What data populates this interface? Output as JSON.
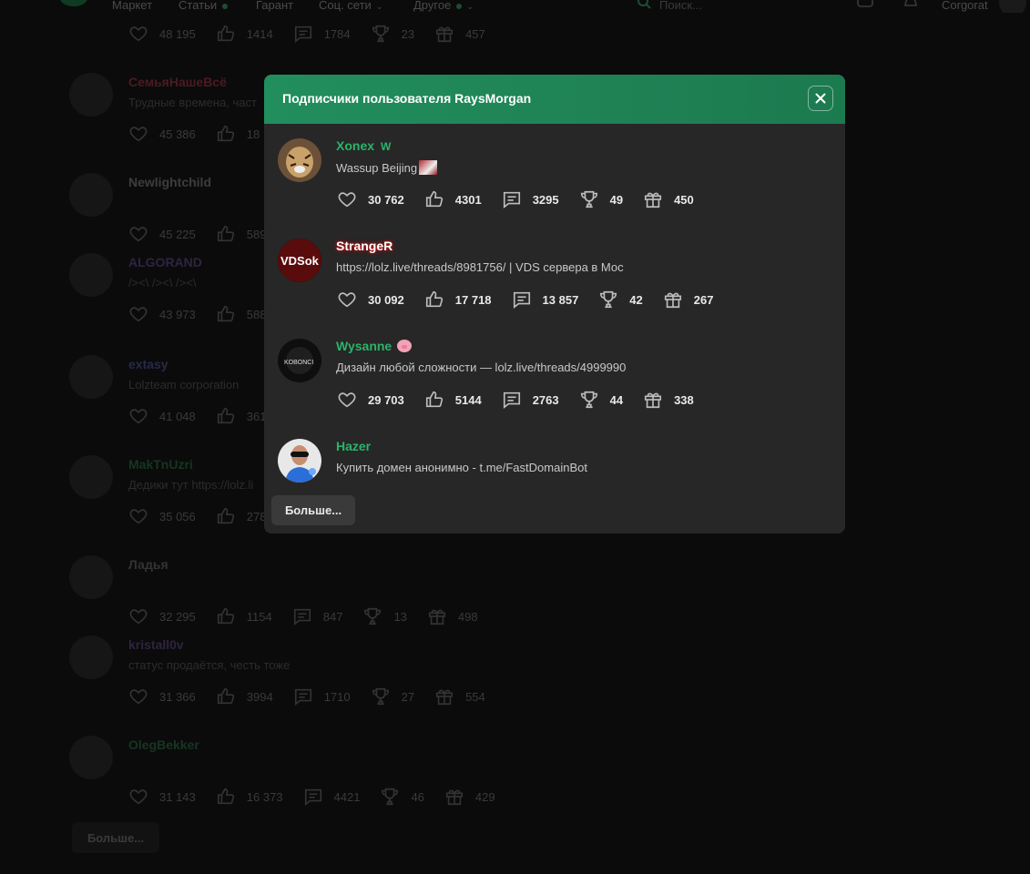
{
  "nav": {
    "items": [
      {
        "label": "Маркет",
        "chevron": false,
        "dot": false
      },
      {
        "label": "Статьи",
        "chevron": false,
        "dot": true
      },
      {
        "label": "Гарант",
        "chevron": false,
        "dot": false
      },
      {
        "label": "Соц. сети",
        "chevron": true,
        "dot": false
      },
      {
        "label": "Другое",
        "chevron": true,
        "dot": true
      }
    ],
    "search_placeholder": "Поиск...",
    "username": "Corgorat"
  },
  "background": {
    "top_stats": {
      "likes": "48 195",
      "reactions": "1414",
      "messages": "1784",
      "trophies": "23",
      "gifts": "457"
    },
    "rows": [
      {
        "name": "СемьяНашеВсё",
        "name_color": "#4a1b22",
        "status": "Трудные времена, част",
        "stats": {
          "likes": "45 386",
          "reactions": "18"
        }
      },
      {
        "name": "Newlightchild",
        "name_color": "#3d3d3d",
        "status": "",
        "stats": {
          "likes": "45 225",
          "reactions": "589"
        }
      },
      {
        "name": "ALGORAND",
        "name_color": "#2f2440",
        "status": "/><\\ /><\\ /><\\",
        "stats": {
          "likes": "43 973",
          "reactions": "588"
        }
      },
      {
        "name": "extasy",
        "name_color": "#262a4a",
        "status": "Lolzteam corporation",
        "stats": {
          "likes": "41 048",
          "reactions": "361"
        }
      },
      {
        "name": "MakTnUzri",
        "name_color": "#173522",
        "status": "Дедики тут https://lolz.li",
        "stats": {
          "likes": "35 056",
          "reactions": "278"
        }
      },
      {
        "name": "Ладья",
        "name_color": "#333333",
        "status": "",
        "stats": {
          "likes": "32 295",
          "reactions": "1154",
          "messages": "847",
          "trophies": "13",
          "gifts": "498"
        }
      },
      {
        "name": "kristall0v",
        "name_color": "#2f2440",
        "status": "статус продаётся, честь тоже",
        "stats": {
          "likes": "31 366",
          "reactions": "3994",
          "messages": "1710",
          "trophies": "27",
          "gifts": "554"
        }
      },
      {
        "name": "OlegBekker",
        "name_color": "#173522",
        "status": "",
        "stats": {
          "likes": "31 143",
          "reactions": "16 373",
          "messages": "4421",
          "trophies": "46",
          "gifts": "429"
        }
      }
    ],
    "more_label": "Больше..."
  },
  "modal": {
    "title": "Подписчики пользователя RaysMorgan",
    "more_label": "Больше...",
    "users": [
      {
        "name": "Xonex",
        "name_color": "#2bb36a",
        "badge": "W",
        "status": "Wassup Beijing",
        "avatar_colors": [
          "#6b5138",
          "#c9a16a"
        ],
        "stats": {
          "likes": "30 762",
          "reactions": "4301",
          "messages": "3295",
          "trophies": "49",
          "gifts": "450"
        }
      },
      {
        "name": "StrangeR",
        "name_color": "#ffffff",
        "status": "https://lolz.live/threads/8981756/ | VDS сервера в Мос",
        "avatar_text": "VDSok",
        "avatar_colors": [
          "#5a0b0b",
          "#1a0000"
        ],
        "stats": {
          "likes": "30 092",
          "reactions": "17 718",
          "messages": "13 857",
          "trophies": "42",
          "gifts": "267"
        }
      },
      {
        "name": "Wysanne",
        "name_color": "#2bb36a",
        "status": "Дизайн любой сложности — lolz.live/threads/4999990",
        "avatar_text": "KOBONCI",
        "avatar_colors": [
          "#0e0e0e",
          "#222"
        ],
        "stats": {
          "likes": "29 703",
          "reactions": "5144",
          "messages": "2763",
          "trophies": "44",
          "gifts": "338"
        }
      },
      {
        "name": "Hazer",
        "name_color": "#2bb36a",
        "status": "Купить домен анонимно - t.me/FastDomainBot",
        "avatar_colors": [
          "#2b6ed8",
          "#e8e8e8"
        ]
      }
    ]
  }
}
